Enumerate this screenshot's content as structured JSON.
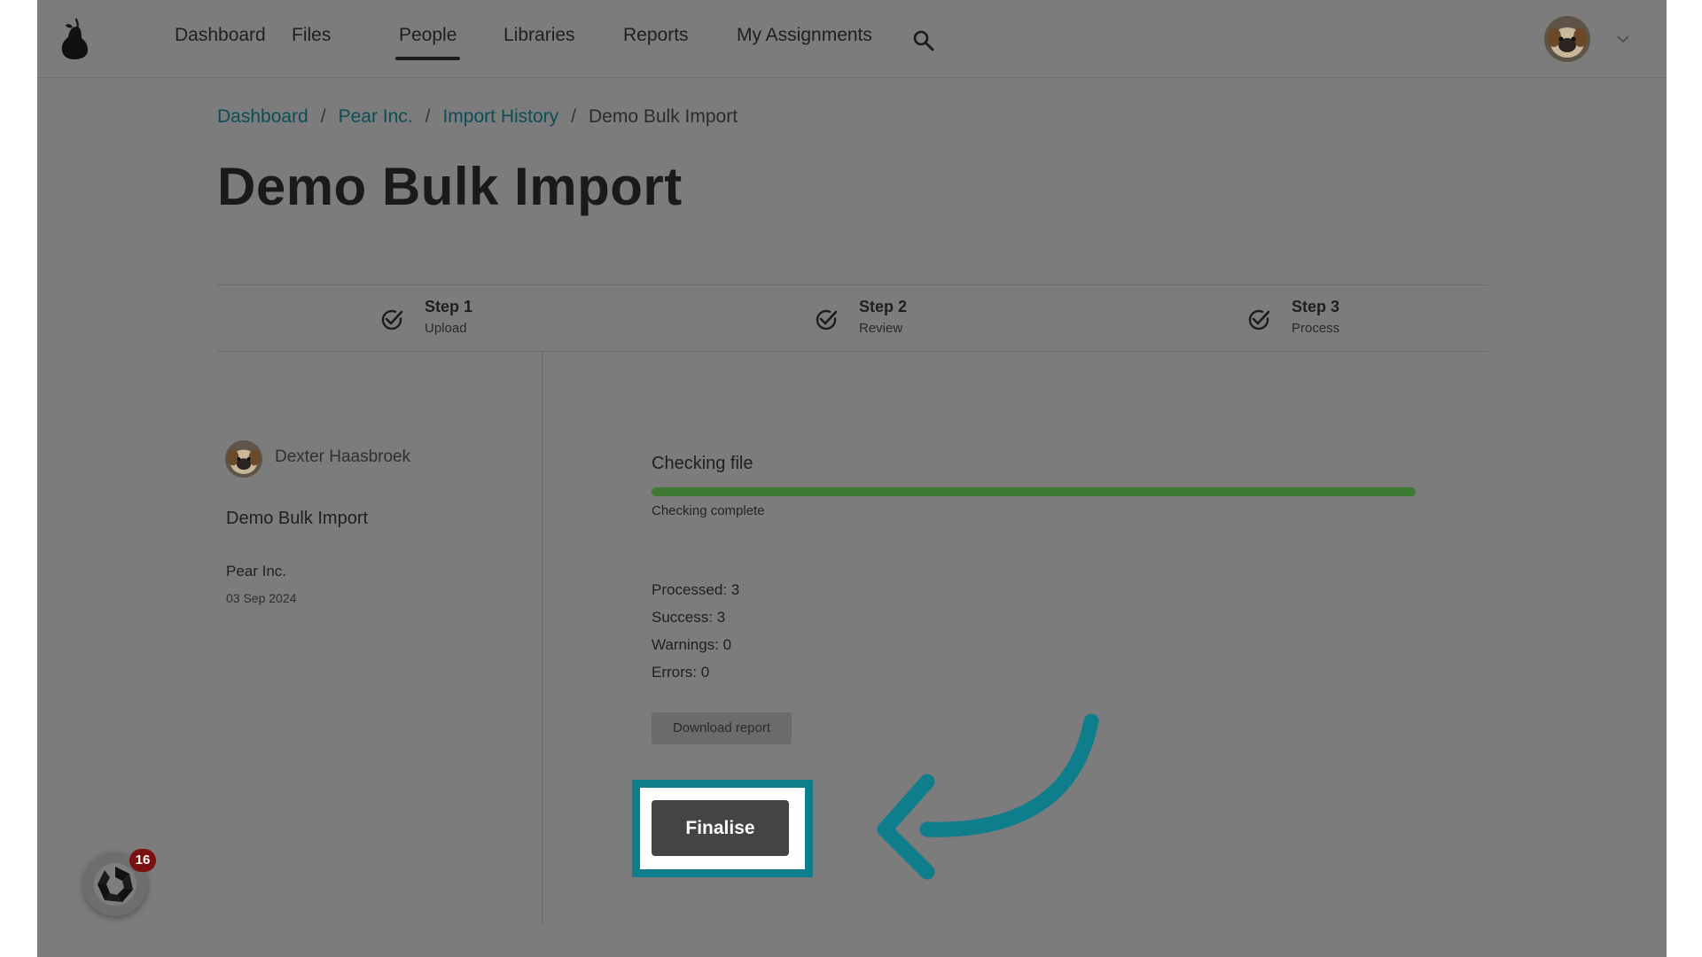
{
  "nav": {
    "items": [
      {
        "label": "Dashboard",
        "active": false
      },
      {
        "label": "Files",
        "active": false
      },
      {
        "label": "People",
        "active": true
      },
      {
        "label": "Libraries",
        "active": false
      },
      {
        "label": "Reports",
        "active": false
      },
      {
        "label": "My Assignments",
        "active": false
      }
    ],
    "search_icon": "search-icon",
    "avatar_icon": "user-avatar",
    "menu_icon": "chevron-down-icon"
  },
  "breadcrumb": {
    "items": [
      "Dashboard",
      "Pear Inc.",
      "Import History"
    ],
    "current": "Demo Bulk Import",
    "separator": "/"
  },
  "page": {
    "title": "Demo Bulk Import"
  },
  "steps": [
    {
      "title": "Step 1",
      "subtitle": "Upload",
      "done": true
    },
    {
      "title": "Step 2",
      "subtitle": "Review",
      "done": true
    },
    {
      "title": "Step 3",
      "subtitle": "Process",
      "done": true
    }
  ],
  "sidebar": {
    "author": "Dexter Haasbroek",
    "import_name": "Demo Bulk Import",
    "organization": "Pear Inc.",
    "date": "03 Sep 2024"
  },
  "check": {
    "title": "Checking file",
    "progress": 1.0,
    "status": "Checking complete"
  },
  "stats": {
    "processed": "Processed: 3",
    "success": "Success: 3",
    "warnings": "Warnings: 0",
    "errors": "Errors: 0"
  },
  "actions": {
    "download_label": "Download report",
    "finalise_label": "Finalise"
  },
  "help_widget": {
    "badge": "16"
  },
  "colors": {
    "overlay_bg": "#7c7c7c",
    "link": "#0c4d56",
    "progress": "#3e7a32",
    "highlight": "#0e7d8c",
    "primary_button": "#444446",
    "badge": "#7a1010"
  }
}
